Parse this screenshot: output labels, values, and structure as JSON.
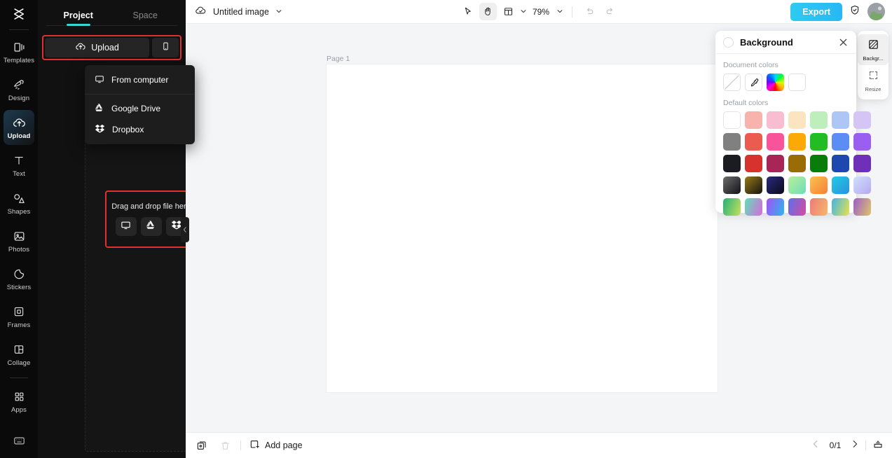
{
  "rail": {
    "logo_icon": "capcut-logo-icon",
    "items": [
      {
        "label": "Templates",
        "icon": "templates-icon",
        "active": false
      },
      {
        "label": "Design",
        "icon": "design-icon",
        "active": false
      },
      {
        "label": "Upload",
        "icon": "upload-cloud-icon",
        "active": true
      },
      {
        "label": "Text",
        "icon": "text-icon",
        "active": false
      },
      {
        "label": "Shapes",
        "icon": "shapes-icon",
        "active": false
      },
      {
        "label": "Photos",
        "icon": "photos-icon",
        "active": false
      },
      {
        "label": "Stickers",
        "icon": "stickers-icon",
        "active": false
      },
      {
        "label": "Frames",
        "icon": "frames-icon",
        "active": false
      },
      {
        "label": "Collage",
        "icon": "collage-icon",
        "active": false
      },
      {
        "label": "Apps",
        "icon": "apps-grid-icon",
        "active": false
      }
    ],
    "bottom_icon": "keyboard-shortcuts-icon"
  },
  "panel": {
    "tabs": [
      {
        "label": "Project",
        "active": true
      },
      {
        "label": "Space",
        "active": false
      }
    ],
    "upload_label": "Upload",
    "upload_icon": "upload-cloud-icon",
    "mobile_icon": "mobile-phone-icon",
    "dropdown": [
      {
        "label": "From computer",
        "icon": "monitor-icon"
      },
      {
        "label": "Google Drive",
        "icon": "google-drive-icon"
      },
      {
        "label": "Dropbox",
        "icon": "dropbox-icon"
      }
    ],
    "dropzone_text": "Drag and drop file here",
    "dropzone_buttons": [
      {
        "icon": "monitor-icon"
      },
      {
        "icon": "google-drive-icon"
      },
      {
        "icon": "dropbox-icon"
      }
    ],
    "highlight_color": "#e03030"
  },
  "topbar": {
    "cloud_icon": "cloud-saved-icon",
    "title": "Untitled image",
    "title_chevron_icon": "chevron-down-icon",
    "tools": [
      {
        "icon": "cursor-select-icon",
        "active": false
      },
      {
        "icon": "hand-pan-icon",
        "active": true
      },
      {
        "icon": "layout-grid-icon",
        "active": false
      }
    ],
    "layout_chevron_icon": "chevron-down-icon",
    "zoom": "79%",
    "zoom_chevron_icon": "chevron-down-icon",
    "undo_icon": "undo-icon",
    "redo_icon": "redo-icon",
    "export_label": "Export",
    "shield_icon": "shield-check-icon",
    "avatar_name": "user-avatar"
  },
  "canvas": {
    "page_label": "Page 1",
    "page_background": "#ffffff",
    "workspace_background": "#f4f5f7"
  },
  "bottombar": {
    "duplicate_icon": "duplicate-page-icon",
    "delete_icon": "trash-icon",
    "add_page_label": "Add page",
    "add_page_icon": "add-page-icon",
    "prev_icon": "chevron-left-icon",
    "page_count": "0/1",
    "next_icon": "chevron-right-icon",
    "pages_icon": "page-manager-icon"
  },
  "background_panel": {
    "title": "Background",
    "close_icon": "close-icon",
    "document_colors_label": "Document colors",
    "document_colors": [
      {
        "name": "none-swatch",
        "type": "none"
      },
      {
        "name": "eyedropper-swatch",
        "type": "eyedropper"
      },
      {
        "name": "rainbow-picker-swatch",
        "type": "rainbow"
      },
      {
        "name": "white-swatch",
        "type": "solid",
        "color": "#ffffff"
      }
    ],
    "default_colors_label": "Default colors",
    "default_colors": [
      [
        "#ffffff",
        "#f8b3ac",
        "#f9bdd2",
        "#fae5c0",
        "#bdeebc",
        "#adc6f5",
        "#d5c5f5"
      ],
      [
        "#808080",
        "#ec5b4f",
        "#f9539c",
        "#fbaa05",
        "#21bd22",
        "#5b8df4",
        "#9a5ef0"
      ],
      [
        "#1b1b22",
        "#d8322e",
        "#a82557",
        "#9a6c05",
        "#0a7c0a",
        "#1f48ae",
        "#6f2fb8"
      ],
      [
        "#2b2b2b",
        "#4a3a10",
        "#131341",
        "#a8e8a8",
        "#f79f4a",
        "#39b7e0",
        "#c2d4f7"
      ],
      [
        "#2ebb7a",
        "#5fe0c0",
        "#9a5cf5",
        "#9b4fc0",
        "#f58a7a",
        "#3fbdf0",
        "#a86fc8"
      ]
    ],
    "gradient_rows": [
      3,
      4
    ]
  },
  "right_panel": {
    "items": [
      {
        "label": "Backgr...",
        "icon": "background-tile-icon",
        "selected": true
      },
      {
        "label": "Resize",
        "icon": "resize-icon",
        "selected": false
      }
    ]
  }
}
